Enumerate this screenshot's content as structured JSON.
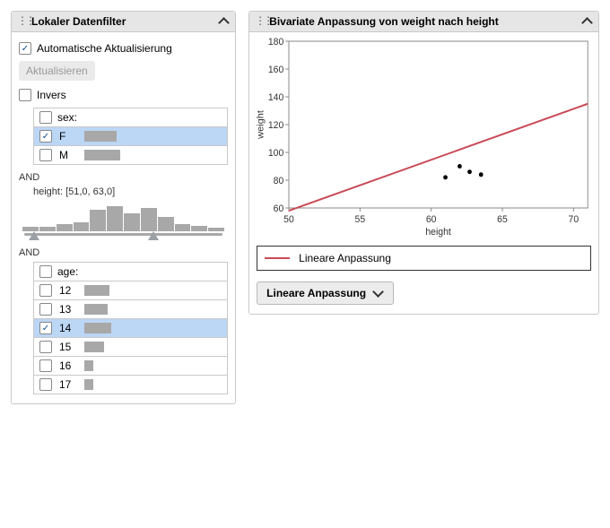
{
  "filter": {
    "title": "Lokaler Datenfilter",
    "autoUpdate": {
      "label": "Automatische Aktualisierung",
      "checked": true
    },
    "updateBtn": "Aktualisieren",
    "inverse": {
      "label": "Invers",
      "checked": false
    },
    "andLabel": "AND",
    "sex": {
      "label": "sex:",
      "headerChecked": false,
      "items": [
        {
          "label": "F",
          "checked": true,
          "bar": 36,
          "selected": true
        },
        {
          "label": "M",
          "checked": false,
          "bar": 40,
          "selected": false
        }
      ]
    },
    "height": {
      "label": "height: [51,0, 63,0]",
      "bars": [
        5,
        5,
        8,
        10,
        24,
        28,
        20,
        26,
        16,
        8,
        6,
        4
      ],
      "handleLeft": 3,
      "handleRight": 62
    },
    "age": {
      "label": "age:",
      "headerChecked": false,
      "items": [
        {
          "label": "12",
          "checked": false,
          "bar": 28,
          "selected": false
        },
        {
          "label": "13",
          "checked": false,
          "bar": 26,
          "selected": false
        },
        {
          "label": "14",
          "checked": true,
          "bar": 30,
          "selected": true
        },
        {
          "label": "15",
          "checked": false,
          "bar": 22,
          "selected": false
        },
        {
          "label": "16",
          "checked": false,
          "bar": 10,
          "selected": false
        },
        {
          "label": "17",
          "checked": false,
          "bar": 10,
          "selected": false
        }
      ]
    }
  },
  "bivariate": {
    "title": "Bivariate Anpassung von weight nach height",
    "legend": "Lineare Anpassung",
    "dropdown": "Lineare Anpassung",
    "xlabel": "height",
    "ylabel": "weight"
  },
  "chart_data": {
    "type": "scatter",
    "title": "Bivariate Anpassung von weight nach height",
    "xlabel": "height",
    "ylabel": "weight",
    "xlim": [
      50,
      71
    ],
    "ylim": [
      60,
      180
    ],
    "xticks": [
      50,
      55,
      60,
      65,
      70
    ],
    "yticks": [
      60,
      80,
      100,
      120,
      140,
      160,
      180
    ],
    "points": [
      {
        "x": 61.0,
        "y": 82
      },
      {
        "x": 62.0,
        "y": 90
      },
      {
        "x": 62.7,
        "y": 86
      },
      {
        "x": 63.5,
        "y": 84
      }
    ],
    "fit_line": {
      "name": "Lineare Anpassung",
      "x": [
        50,
        71
      ],
      "y": [
        58,
        135
      ]
    }
  }
}
